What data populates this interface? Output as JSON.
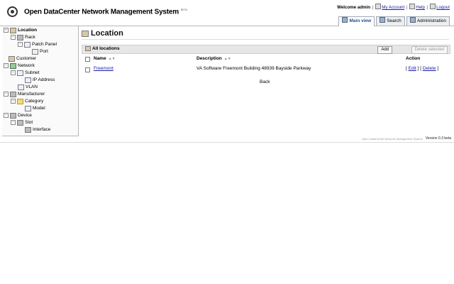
{
  "app": {
    "title": "Open DataCenter Network Management System",
    "title_sup": "BETA",
    "welcome": "Welcome admin",
    "links": [
      "My Account",
      "Help",
      "Logout"
    ]
  },
  "tabs": [
    "Main view",
    "Search",
    "Administration"
  ],
  "sidebar": {
    "items": [
      "Location",
      "Rack",
      "Patch Panel",
      "Port",
      "Customer",
      "Network",
      "Subnet",
      "IP Address",
      "VLAN",
      "Manufacturer",
      "Category",
      "Model",
      "Device",
      "Slot",
      "Interface"
    ]
  },
  "main": {
    "title": "Location",
    "panel_label": "All locations",
    "add_label": "Add",
    "delete_selected_label": "Delete selected",
    "columns": [
      "Name",
      "Description",
      "Action"
    ],
    "rows": [
      {
        "name": "Freemont",
        "description": "VA Software Freemont Building 48939 Bayside Parkway",
        "edit": "Edit",
        "delete": "Delete"
      }
    ],
    "back_label": "Back"
  },
  "footer": {
    "note": "Open DataCenter Network Management System",
    "version": "Version 0.3 beta"
  }
}
